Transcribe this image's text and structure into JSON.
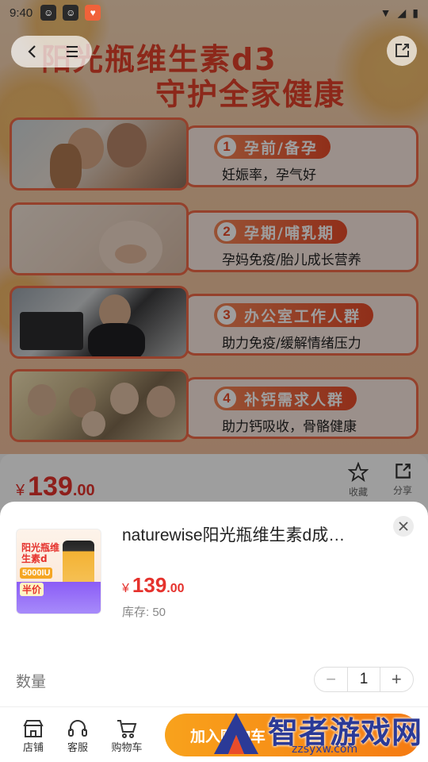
{
  "status_bar": {
    "time": "9:40"
  },
  "banner": {
    "title_line1": "阳光瓶维生素d3",
    "title_line2": "守护全家健康",
    "cards": [
      {
        "num": "1",
        "title": "孕前/备孕",
        "desc": "妊娠率，孕气好"
      },
      {
        "num": "2",
        "title": "孕期/哺乳期",
        "desc": "孕妈免疫/胎儿成长营养"
      },
      {
        "num": "3",
        "title": "办公室工作人群",
        "desc": "助力免疫/缓解情绪压力"
      },
      {
        "num": "4",
        "title": "补钙需求人群",
        "desc": "助力钙吸收，骨骼健康"
      }
    ]
  },
  "price_strip": {
    "symbol": "¥",
    "integer": "139",
    "decimal": ".00",
    "favorite_label": "收藏",
    "share_label": "分享"
  },
  "sheet": {
    "thumb": {
      "title": "阳光瓶维生素d",
      "iu": "5000IU",
      "half": "半价"
    },
    "title": "naturewise阳光瓶维生素d成…",
    "price_symbol": "¥",
    "price_integer": "139",
    "price_decimal": ".00",
    "stock": "库存: 50",
    "qty_label": "数量",
    "qty_value": "1",
    "minus": "−",
    "plus": "+"
  },
  "bottom_bar": {
    "store_label": "店铺",
    "service_label": "客服",
    "cart_label": "购物车",
    "add_to_cart": "加入购物车"
  },
  "watermark": {
    "text": "智者游戏网",
    "url": "zzsyxw.com"
  },
  "colors": {
    "accent": "#e5322d",
    "cart_button": "#f8a21c",
    "card_border": "#f06a48"
  }
}
